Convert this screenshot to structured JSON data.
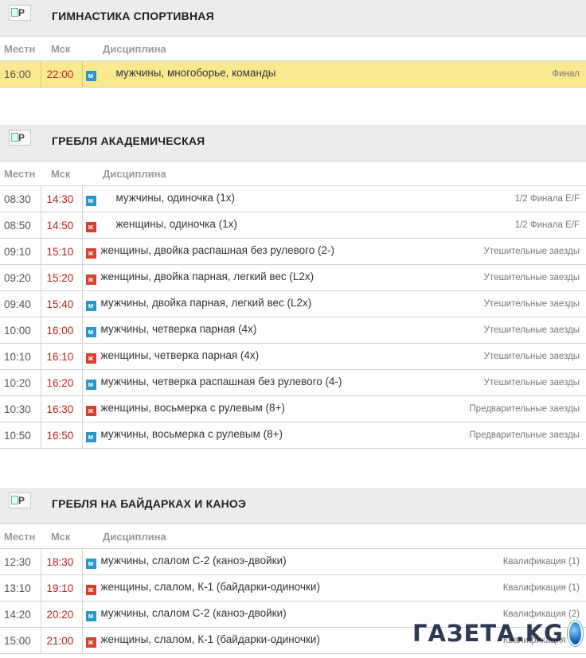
{
  "headers": {
    "local": "Местн",
    "msk": "Мск",
    "discipline": "Дисциплина"
  },
  "sections": [
    {
      "title": "ГИМНАСТИКА СПОРТИВНАЯ",
      "icon_alt": "P",
      "rows": [
        {
          "local": "16:00",
          "msk": "22:00",
          "gender": "м",
          "gender_icon": "male-badge-icon",
          "discipline": "мужчины, многоборье, команды",
          "stage": "Финал",
          "highlight": true
        }
      ]
    },
    {
      "title": "ГРЕБЛЯ АКАДЕМИЧЕСКАЯ",
      "icon_alt": "P",
      "rows": [
        {
          "local": "08:30",
          "msk": "14:30",
          "gender": "м",
          "discipline": "мужчины, одиночка (1х)",
          "stage": "1/2 Финала E/F",
          "indent": true
        },
        {
          "local": "08:50",
          "msk": "14:50",
          "gender": "ж",
          "discipline": "женщины, одиночка (1х)",
          "stage": "1/2 Финала E/F",
          "indent": true
        },
        {
          "local": "09:10",
          "msk": "15:10",
          "gender": "ж",
          "discipline": "женщины, двойка распашная без рулевого (2-)",
          "stage": "Утешительные заезды"
        },
        {
          "local": "09:20",
          "msk": "15:20",
          "gender": "ж",
          "discipline": "женщины, двойка парная, легкий вес (L2x)",
          "stage": "Утешительные заезды"
        },
        {
          "local": "09:40",
          "msk": "15:40",
          "gender": "м",
          "discipline": "мужчины, двойка парная, легкий вес (L2x)",
          "stage": "Утешительные заезды"
        },
        {
          "local": "10:00",
          "msk": "16:00",
          "gender": "м",
          "discipline": "мужчины, четверка парная (4х)",
          "stage": "Утешительные заезды"
        },
        {
          "local": "10:10",
          "msk": "16:10",
          "gender": "ж",
          "discipline": "женщины, четверка парная (4х)",
          "stage": "Утешительные заезды"
        },
        {
          "local": "10:20",
          "msk": "16:20",
          "gender": "м",
          "discipline": "мужчины, четверка распашная без рулевого (4-)",
          "stage": "Утешительные заезды"
        },
        {
          "local": "10:30",
          "msk": "16:30",
          "gender": "ж",
          "discipline": "женщины, восьмерка с рулевым (8+)",
          "stage": "Предварительные заезды"
        },
        {
          "local": "10:50",
          "msk": "16:50",
          "gender": "м",
          "discipline": "мужчины, восьмерка с рулевым (8+)",
          "stage": "Предварительные заезды"
        }
      ]
    },
    {
      "title": "ГРЕБЛЯ НА БАЙДАРКАХ И КАНОЭ",
      "icon_alt": "P",
      "rows": [
        {
          "local": "12:30",
          "msk": "18:30",
          "gender": "м",
          "discipline": "мужчины, слалом С-2 (каноэ-двойки)",
          "stage": "Квалификация (1)"
        },
        {
          "local": "13:10",
          "msk": "19:10",
          "gender": "ж",
          "discipline": "женщины, слалом, К-1 (байдарки-одиночки)",
          "stage": "Квалификация (1)"
        },
        {
          "local": "14:20",
          "msk": "20:20",
          "gender": "м",
          "discipline": "мужчины, слалом С-2 (каноэ-двойки)",
          "stage": "Квалификация (2)"
        },
        {
          "local": "15:00",
          "msk": "21:00",
          "gender": "ж",
          "discipline": "женщины, слалом, К-1 (байдарки-одиночки)",
          "stage": "Квалификация (2)"
        }
      ]
    }
  ],
  "watermark": {
    "text": "ГАЗЕТА.KG"
  },
  "colors": {
    "highlight": "#fbe98f",
    "male_badge": "#2c97c9",
    "female_badge": "#d9402f",
    "msk_time": "#bb2222"
  }
}
